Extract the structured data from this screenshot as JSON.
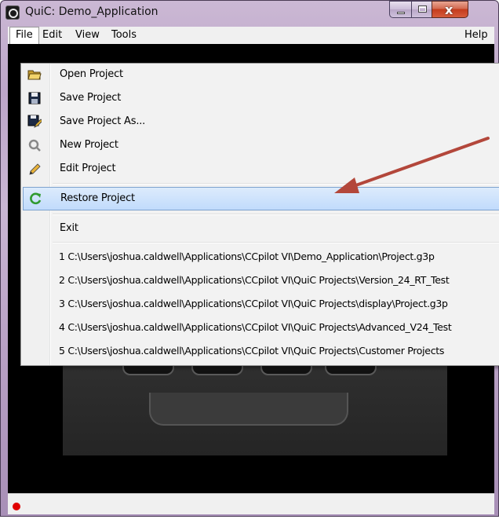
{
  "window": {
    "title": "QuiC: Demo_Application",
    "close_glyph": "x"
  },
  "menubar": {
    "file": "File",
    "edit": "Edit",
    "view": "View",
    "tools": "Tools",
    "help": "Help"
  },
  "file_menu": {
    "items": [
      {
        "label": "Open Project",
        "icon": "folder-open-icon"
      },
      {
        "label": "Save Project",
        "icon": "floppy-disk-icon"
      },
      {
        "label": "Save Project As...",
        "icon": "floppy-disk-pencil-icon"
      },
      {
        "label": "New Project",
        "icon": "quic-logo-icon"
      },
      {
        "label": "Edit Project",
        "icon": "pencil-icon"
      },
      {
        "label": "Restore Project",
        "icon": "refresh-icon"
      },
      {
        "label": "Exit",
        "icon": ""
      }
    ],
    "recent": [
      "1 C:\\Users\\joshua.caldwell\\Applications\\CCpilot VI\\Demo_Application\\Project.g3p",
      "2 C:\\Users\\joshua.caldwell\\Applications\\CCpilot VI\\QuiC Projects\\Version_24_RT_Test",
      "3 C:\\Users\\joshua.caldwell\\Applications\\CCpilot VI\\QuiC Projects\\display\\Project.g3p",
      "4 C:\\Users\\joshua.caldwell\\Applications\\CCpilot VI\\QuiC Projects\\Advanced_V24_Test",
      "5 C:\\Users\\joshua.caldwell\\Applications\\CCpilot VI\\QuiC Projects\\Customer Projects"
    ]
  },
  "colors": {
    "highlight": "#c1dbfc",
    "arrow": "#b3473b",
    "status_indicator": "#e00000"
  }
}
